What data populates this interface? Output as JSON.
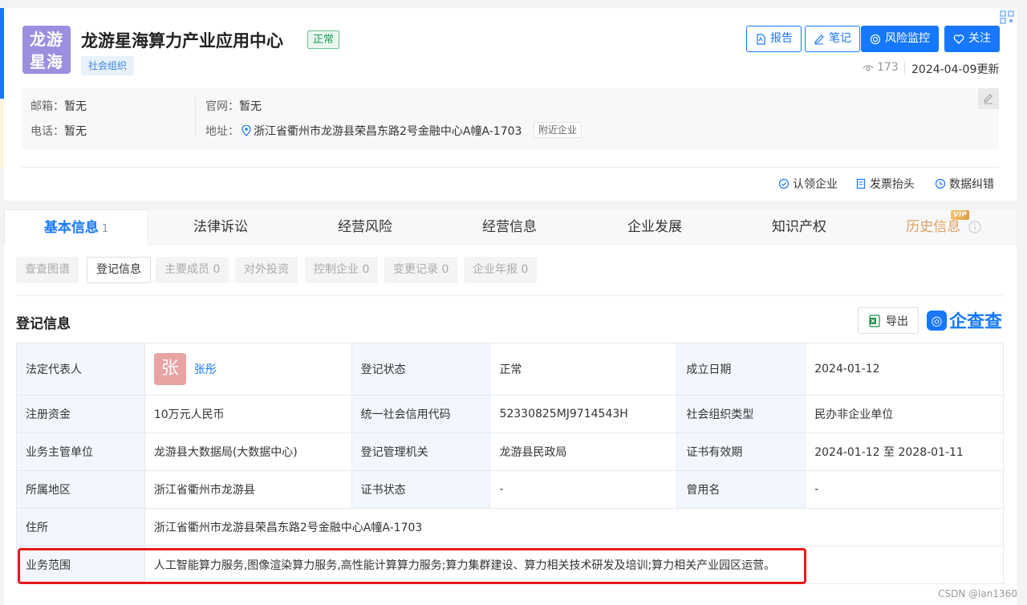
{
  "company": {
    "logo_text": "龙游星海",
    "name": "龙游星海算力产业应用中心",
    "status": "正常",
    "org_tag": "社会组织",
    "views": "173",
    "updated": "2024-04-09更新"
  },
  "buttons": {
    "report": "报告",
    "notes": "笔记",
    "risk": "风险监控",
    "follow": "关注"
  },
  "contact": {
    "email_label": "邮箱：",
    "email_value": "暂无",
    "phone_label": "电话：",
    "phone_value": "暂无",
    "website_label": "官网：",
    "website_value": "暂无",
    "address_label": "地址：",
    "address_value": "浙江省衢州市龙游县荣昌东路2号金融中心A幢A-1703",
    "nearby": "附近企业"
  },
  "actions": {
    "claim": "认领企业",
    "invoice": "发票抬头",
    "correction": "数据纠错"
  },
  "tabs": [
    {
      "label": "基本信息",
      "count": "1"
    },
    {
      "label": "法律诉讼"
    },
    {
      "label": "经营风险"
    },
    {
      "label": "经营信息"
    },
    {
      "label": "企业发展"
    },
    {
      "label": "知识产权"
    },
    {
      "label": "历史信息",
      "badge": "VIP"
    }
  ],
  "subtabs": [
    "查查图谱",
    "登记信息",
    "主要成员 0",
    "对外投资",
    "控制企业 0",
    "变更记录 0",
    "企业年报 0"
  ],
  "section": {
    "title": "登记信息",
    "export": "导出",
    "brand": "企查查"
  },
  "table": {
    "legal_rep_label": "法定代表人",
    "legal_rep_avatar": "张",
    "legal_rep_name": "张彤",
    "reg_status_label": "登记状态",
    "reg_status": "正常",
    "found_date_label": "成立日期",
    "found_date": "2024-01-12",
    "capital_label": "注册资金",
    "capital": "10万元人民币",
    "credit_code_label": "统一社会信用代码",
    "credit_code": "52330825MJ9714543H",
    "org_type_label": "社会组织类型",
    "org_type": "民办非企业单位",
    "authority_label": "业务主管单位",
    "authority": "龙游县大数据局(大数据中心)",
    "registrar_label": "登记管理机关",
    "registrar": "龙游县民政局",
    "cert_valid_label": "证书有效期",
    "cert_valid": "2024-01-12 至 2028-01-11",
    "region_label": "所属地区",
    "region": "浙江省衢州市龙游县",
    "cert_status_label": "证书状态",
    "cert_status": "-",
    "former_name_label": "曾用名",
    "former_name": "-",
    "residence_label": "住所",
    "residence": "浙江省衢州市龙游县荣昌东路2号金融中心A幢A-1703",
    "scope_label": "业务范围",
    "scope": "人工智能算力服务,图像渲染算力服务,高性能计算算力服务;算力集群建设、算力相关技术研发及培训;算力相关产业园区运营。"
  },
  "watermark": "CSDN @lan1360",
  "colors": {
    "accent": "#1677ff",
    "status_green": "#1b9e52",
    "highlight_red": "#e8191c",
    "logo_purple": "#9b8fe0"
  }
}
